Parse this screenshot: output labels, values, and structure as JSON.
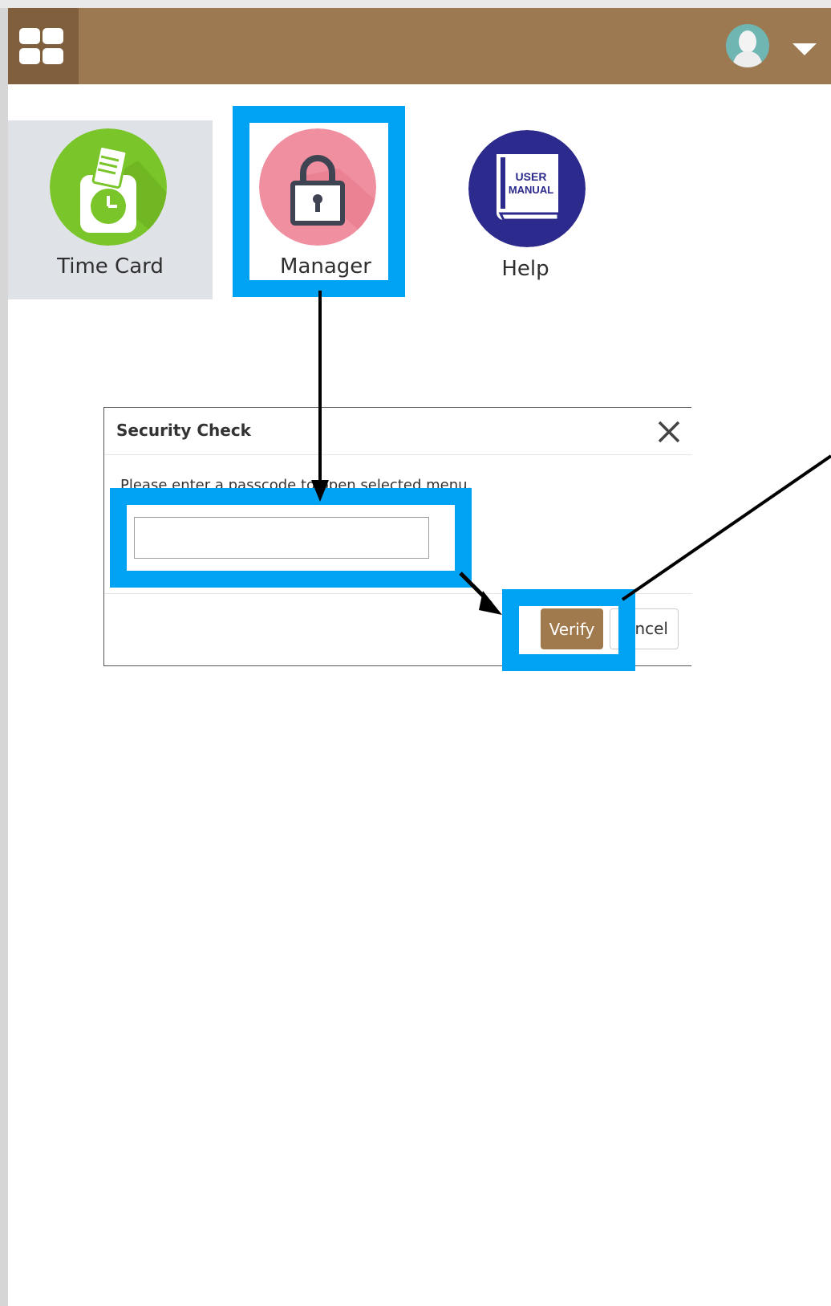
{
  "tiles": [
    {
      "label": "Time Card",
      "icon": "timecard-icon"
    },
    {
      "label": "Manager",
      "icon": "lock-icon"
    },
    {
      "label": "Help",
      "icon": "user-manual-icon"
    }
  ],
  "help_icon_text": [
    "USER",
    "MANUAL"
  ],
  "dialog": {
    "title": "Security Check",
    "message": "Please enter a passcode to open selected menu.",
    "passcode_value": "",
    "verify_label": "Verify",
    "cancel_label": "ancel"
  },
  "colors": {
    "header": "#9c7950",
    "header_button": "#805f3c",
    "highlight": "#00a2f4",
    "verify_button": "#a07a4c",
    "timecard_circle": "#7ac52a",
    "manager_circle": "#ef8fa0",
    "help_circle": "#2c2a8c"
  }
}
